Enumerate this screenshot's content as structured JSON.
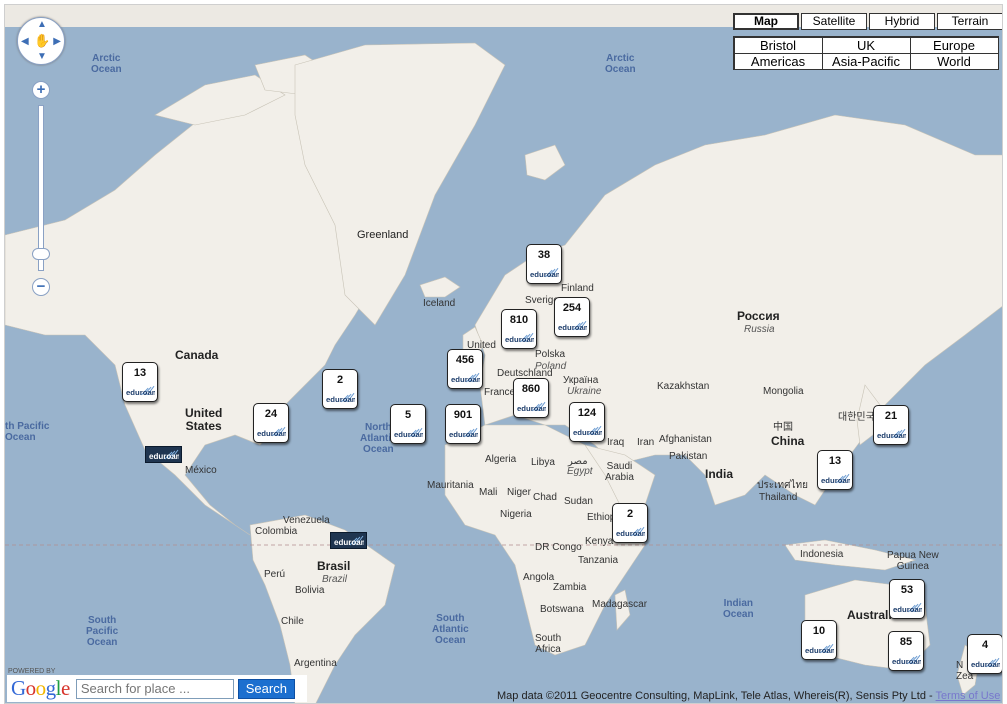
{
  "map_types": [
    {
      "label": "Map",
      "active": true
    },
    {
      "label": "Satellite",
      "active": false
    },
    {
      "label": "Hybrid",
      "active": false
    },
    {
      "label": "Terrain",
      "active": false
    }
  ],
  "regions": [
    "Bristol",
    "UK",
    "Europe",
    "Americas",
    "Asia-Pacific",
    "World"
  ],
  "labels": {
    "arctic_w": "Arctic\nOcean",
    "arctic_e": "Arctic\nOcean",
    "greenland": "Greenland",
    "iceland": "Iceland",
    "canada": "Canada",
    "us": "United\nStates",
    "mexico": "México",
    "venezuela": "Venezuela",
    "colombia": "Colombia",
    "peru": "Perú",
    "brasil": "Brasil",
    "brazil": "Brazil",
    "bolivia": "Bolivia",
    "chile": "Chile",
    "argentina": "Argentina",
    "n_pacific": "th Pacific\nOcean",
    "n_atlantic": "North\nAtlantic\nOcean",
    "s_pacific": "South\nPacific\nOcean",
    "s_atlantic": "South\nAtlantic\nOcean",
    "indian": "Indian\nOcean",
    "finland": "Finland",
    "sverige": "Sverige",
    "united": "United",
    "polska": "Polska",
    "deutschland": "Deutschland",
    "france": "France",
    "ukraina": "Україна",
    "ukraine": "Ukraine",
    "poland": "Poland",
    "russia_ru": "Россия",
    "russia": "Russia",
    "kazakhstan": "Kazakhstan",
    "mongolia": "Mongolia",
    "china_zh": "中国",
    "china": "China",
    "korea": "대한민국",
    "iraq": "Iraq",
    "iran": "Iran",
    "afghanistan": "Afghanistan",
    "pakistan": "Pakistan",
    "india": "India",
    "thailand_th": "ประเทศไทย",
    "thailand": "Thailand",
    "algeria": "Algeria",
    "libya": "Libya",
    "egypt_ar": "مصر",
    "egypt": "Egypt",
    "saudi": "Saudi\nArabia",
    "mauritania": "Mauritania",
    "mali": "Mali",
    "niger": "Niger",
    "chad": "Chad",
    "sudan": "Sudan",
    "nigeria": "Nigeria",
    "ethiopia": "Ethiop",
    "kenya": "Kenya",
    "drc": "DR Congo",
    "tanzania": "Tanzania",
    "angola": "Angola",
    "zambia": "Zambia",
    "botswana": "Botswana",
    "madagascar": "Madagascar",
    "south_africa": "South\nAfrica",
    "indonesia": "Indonesia",
    "png": "Papua New\nGuinea",
    "australia": "Australi",
    "nz": "N\nZea"
  },
  "markers": [
    {
      "count": "13"
    },
    {
      "count": "2"
    },
    {
      "count": "24"
    },
    {
      "count": "5"
    },
    {
      "count": "456"
    },
    {
      "count": "901"
    },
    {
      "count": "810"
    },
    {
      "count": "38"
    },
    {
      "count": "254"
    },
    {
      "count": "860"
    },
    {
      "count": "124"
    },
    {
      "count": "2"
    },
    {
      "count": "21"
    },
    {
      "count": "13"
    },
    {
      "count": "53"
    },
    {
      "count": "10"
    },
    {
      "count": "85"
    },
    {
      "count": "4"
    }
  ],
  "pins": [
    {
      "logo": "eduroam"
    },
    {
      "logo": "eduroam"
    }
  ],
  "logo_text": "eduroam",
  "search": {
    "powered_by": "POWERED BY",
    "google": "Google",
    "placeholder": "Search for place ...",
    "button": "Search"
  },
  "attribution": {
    "text": "Map data ©2011 Geocentre Consulting, MapLink, Tele Atlas, Whereis(R), Sensis Pty Ltd - ",
    "link": "Terms of Use"
  },
  "colors": {
    "water": "#99b3cc",
    "land": "#f2efe9",
    "pin": "#1f3550",
    "accent": "#1c6fcf"
  }
}
